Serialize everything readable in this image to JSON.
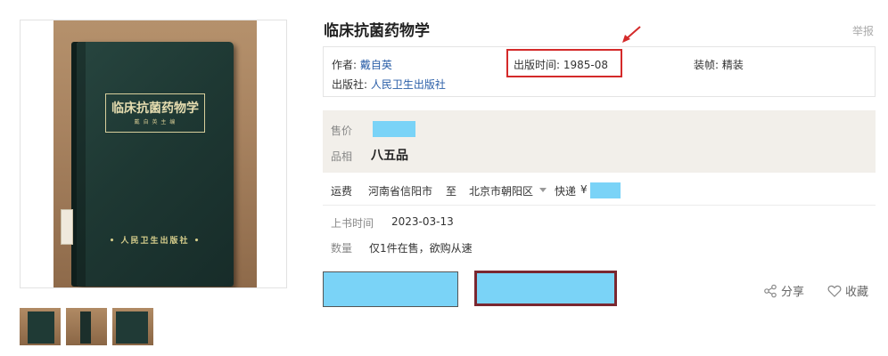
{
  "product": {
    "title": "临床抗菌药物学",
    "report_label": "举报"
  },
  "cover": {
    "title_text": "临床抗菌药物学",
    "editor_text": "戴 自 英 主 编",
    "publisher_text": "• 人民卫生出版社 •"
  },
  "attributes": {
    "author_label": "作者:",
    "author_value": "戴自英",
    "publish_time_label": "出版时间:",
    "publish_time_value": "1985-08",
    "binding_label": "装帧:",
    "binding_value": "精装",
    "publisher_label": "出版社:",
    "publisher_value": "人民卫生出版社"
  },
  "price": {
    "price_label": "售价",
    "condition_label": "品相",
    "condition_value": "八五品"
  },
  "shipping": {
    "label": "运费",
    "from": "河南省信阳市",
    "to_label": "至",
    "to": "北京市朝阳区",
    "method": "快递",
    "currency": "¥"
  },
  "listing": {
    "listed_label": "上书时间",
    "listed_value": "2023-03-13",
    "quantity_label": "数量",
    "quantity_value": "仅1件在售，欲购从速"
  },
  "actions": {
    "share_label": "分享",
    "favorite_label": "收藏"
  },
  "colors": {
    "redaction": "#7ad3f7",
    "highlight": "#d42a2a",
    "buy_border": "#7a2730",
    "link": "#2b5fa8",
    "book_cover": "#1e3833"
  },
  "icons": {
    "share": "share-icon",
    "favorite": "heart-icon",
    "arrow": "annotation-arrow-icon",
    "dropdown": "caret-down-icon"
  }
}
